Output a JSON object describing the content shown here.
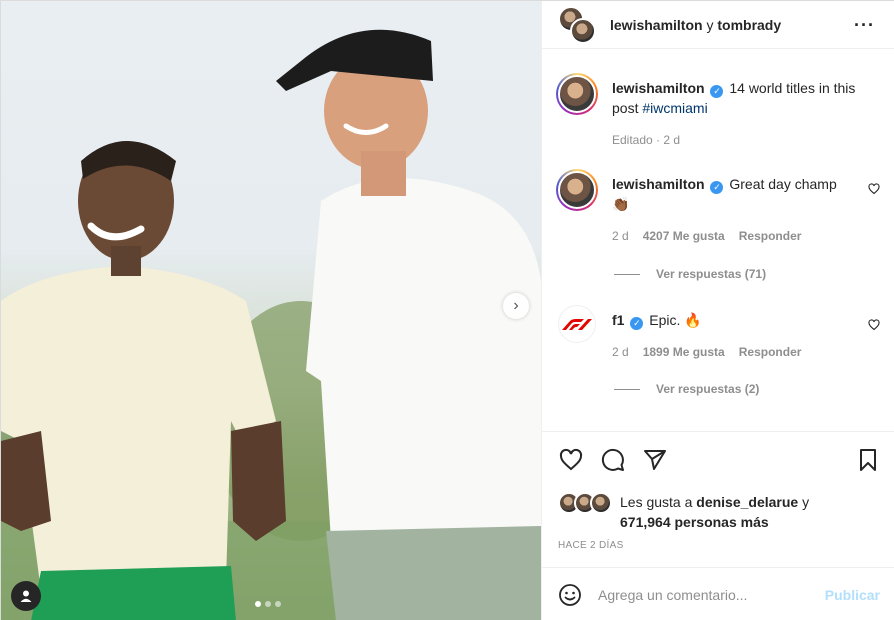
{
  "post": {
    "header_user1": "lewishamilton",
    "header_conj": "y",
    "header_user2": "tombrady",
    "more_icon": "more-horizontal-icon"
  },
  "caption": {
    "username": "lewishamilton",
    "text": "14 world titles in this post",
    "hashtag": "#iwcmiami",
    "meta": "Editado · 2 d"
  },
  "comments": [
    {
      "username": "lewishamilton",
      "text": "Great day champ",
      "emoji": "👏🏾",
      "age": "2 d",
      "likes": "4207 Me gusta",
      "reply": "Responder",
      "view_replies": "Ver respuestas (71)"
    },
    {
      "username": "f1",
      "text": "Epic.",
      "emoji": "🔥",
      "age": "2 d",
      "likes": "1899 Me gusta",
      "reply": "Responder",
      "view_replies": "Ver respuestas (2)"
    }
  ],
  "likes": {
    "prefix": "Les gusta a",
    "user": "denise_delarue",
    "conj": "y",
    "count": "671,964 personas más"
  },
  "date_label": "HACE 2 DÍAS",
  "comment_input": {
    "placeholder": "Agrega un comentario...",
    "publish": "Publicar"
  },
  "colors": {
    "accent": "#3897f0",
    "publish_disabled": "#b2dffc"
  },
  "carousel": {
    "dots": 3,
    "active": 1
  }
}
